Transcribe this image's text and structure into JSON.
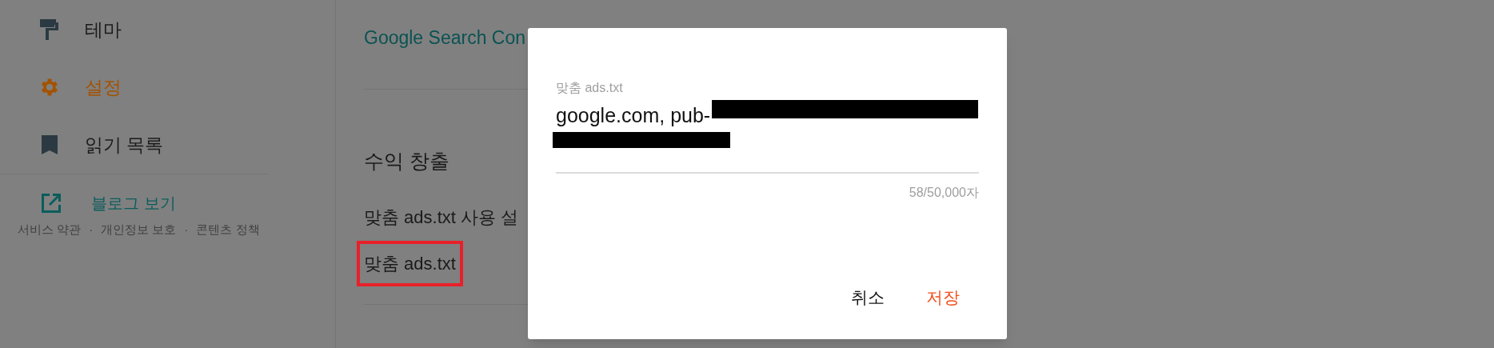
{
  "sidebar": {
    "items": [
      {
        "label": "테마",
        "selected": false
      },
      {
        "label": "설정",
        "selected": true
      },
      {
        "label": "읽기 목록",
        "selected": false
      }
    ],
    "view_blog": "블로그 보기",
    "footer_links": [
      "서비스 약관",
      "개인정보 보호",
      "콘텐츠 정책"
    ],
    "footer_separator": "·"
  },
  "main": {
    "link": "Google Search Con",
    "section_title": "수익 창출",
    "settings": [
      {
        "label": "맞춤 ads.txt 사용 설",
        "highlighted": false
      },
      {
        "label": "맞춤 ads.txt",
        "highlighted": true
      }
    ]
  },
  "dialog": {
    "field_label": "맞춤 ads.txt",
    "value": "google.com, pub-",
    "counter": "58/50,000자",
    "buttons": [
      {
        "label": "취소",
        "kind": "secondary"
      },
      {
        "label": "저장",
        "kind": "primary"
      }
    ]
  }
}
